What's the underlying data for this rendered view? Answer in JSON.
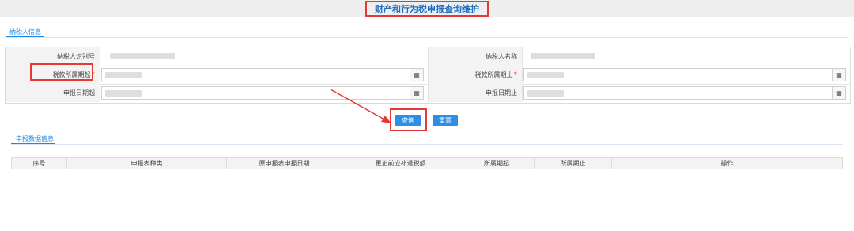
{
  "page_title": "财产和行为税申报查询维护",
  "taxpayer_section": {
    "tab_label": "纳税人信息"
  },
  "form": {
    "taxpayer_id_label": "纳税人识别号",
    "taxpayer_name_label": "纳税人名称",
    "period_start_label": "税款所属期起",
    "period_end_label": "税款所属期止",
    "required_mark": "*",
    "declare_start_label": "申报日期起",
    "declare_end_label": "申报日期止",
    "calendar_glyph": "▦"
  },
  "actions": {
    "query_label": "查询",
    "reset_label": "重置"
  },
  "declaration_section": {
    "tab_label": "申报数据信息"
  },
  "table": {
    "columns": [
      "序号",
      "申报表种类",
      "原申报表申报日期",
      "更正前应补退税额",
      "所属期起",
      "所属期止",
      "操作"
    ]
  },
  "colors": {
    "accent": "#1e88e5",
    "button": "#2d8ee8",
    "highlight": "#e53935"
  }
}
